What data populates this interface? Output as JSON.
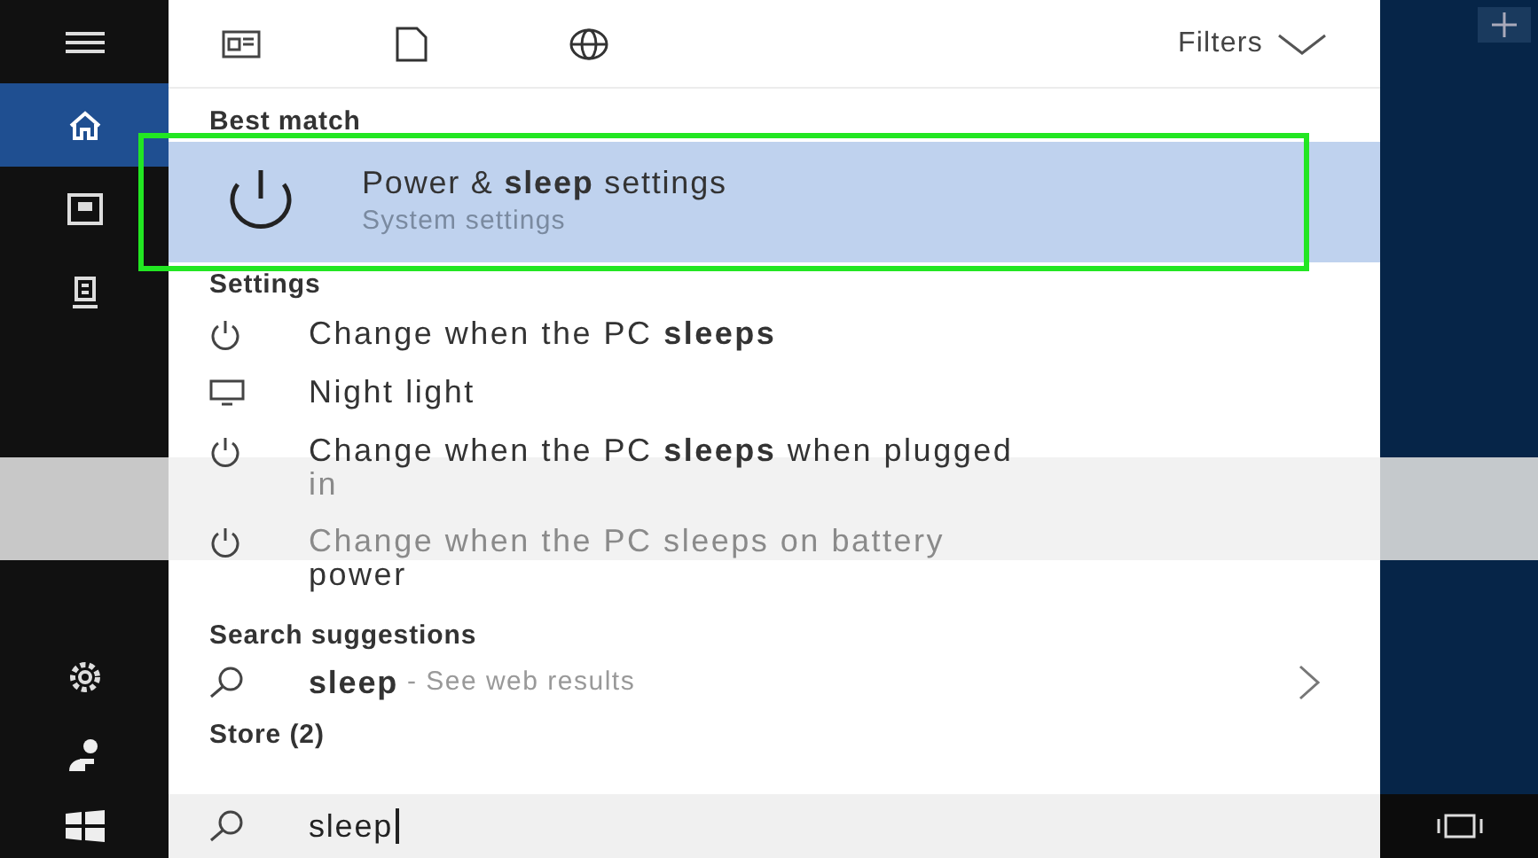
{
  "sidebar": {
    "items": [
      {
        "selected": false
      },
      {
        "selected": true
      },
      {
        "selected": false
      },
      {
        "selected": false
      }
    ]
  },
  "toolbar": {
    "filters": "Filters"
  },
  "best_match": {
    "header": "Best match",
    "title": "Power & **sleep** settings",
    "subtitle": "System settings",
    "selected": true,
    "outlined": true
  },
  "settings": {
    "header": "Settings",
    "items": [
      {
        "kind": "power",
        "lines": [
          {
            "text": "Change when the PC **sleeps**",
            "dimmed": false
          }
        ]
      },
      {
        "kind": "display",
        "lines": [
          {
            "text": "Night light",
            "dimmed": false
          }
        ]
      },
      {
        "kind": "power",
        "lines": [
          {
            "text": "Change when the PC **sleeps** when plugged",
            "dimmed": false
          },
          {
            "text": "in",
            "dimmed": true
          }
        ]
      },
      {
        "kind": "power",
        "lines": [
          {
            "text": "Change when the PC sleeps on battery",
            "dimmed": true
          },
          {
            "text": "power",
            "dimmed": false
          }
        ]
      }
    ]
  },
  "suggestions": {
    "header": "Search suggestions",
    "items": [
      {
        "query": "sleep",
        "hint": " - See web results"
      }
    ]
  },
  "store": {
    "header": "Store (2)"
  },
  "search": {
    "value": "sleep"
  }
}
